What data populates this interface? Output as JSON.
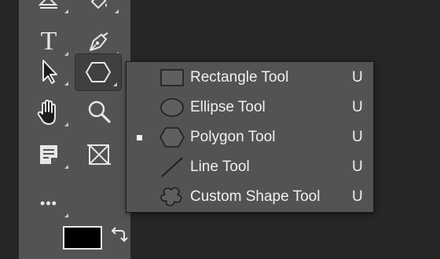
{
  "toolbar": {
    "tools": [
      {
        "name": "eraser-tool",
        "icon": "eraser-icon",
        "has_submenu": true
      },
      {
        "name": "paint-bucket-tool",
        "icon": "paint-bucket-icon",
        "has_submenu": true
      },
      {
        "name": "type-tool",
        "icon": "type-icon",
        "label": "T",
        "has_submenu": true
      },
      {
        "name": "pen-tool",
        "icon": "pen-icon",
        "has_submenu": true
      },
      {
        "name": "path-selection-tool",
        "icon": "arrow-cursor-icon",
        "has_submenu": true
      },
      {
        "name": "shape-tool",
        "icon": "hexagon-icon",
        "has_submenu": true,
        "selected": true
      },
      {
        "name": "hand-tool",
        "icon": "hand-icon",
        "has_submenu": true
      },
      {
        "name": "zoom-tool",
        "icon": "magnifier-icon",
        "has_submenu": false
      },
      {
        "name": "note-tool",
        "icon": "note-icon",
        "has_submenu": true
      },
      {
        "name": "frame-tool",
        "icon": "frame-icon",
        "has_submenu": false
      },
      {
        "name": "edit-toolbar",
        "icon": "ellipsis-icon",
        "label": "•••",
        "has_submenu": true
      }
    ],
    "foreground_color": "#000000"
  },
  "shape_menu": {
    "items": [
      {
        "label": "Rectangle Tool",
        "shortcut": "U",
        "icon": "rectangle-icon",
        "active": false
      },
      {
        "label": "Ellipse Tool",
        "shortcut": "U",
        "icon": "ellipse-icon",
        "active": false
      },
      {
        "label": "Polygon Tool",
        "shortcut": "U",
        "icon": "polygon-icon",
        "active": true
      },
      {
        "label": "Line Tool",
        "shortcut": "U",
        "icon": "line-icon",
        "active": false
      },
      {
        "label": "Custom Shape Tool",
        "shortcut": "U",
        "icon": "custom-shape-icon",
        "active": false
      }
    ]
  },
  "colors": {
    "toolbar_bg": "#535353",
    "menu_bg": "#535353",
    "canvas_bg": "#262626",
    "text": "#f0f0f0"
  }
}
